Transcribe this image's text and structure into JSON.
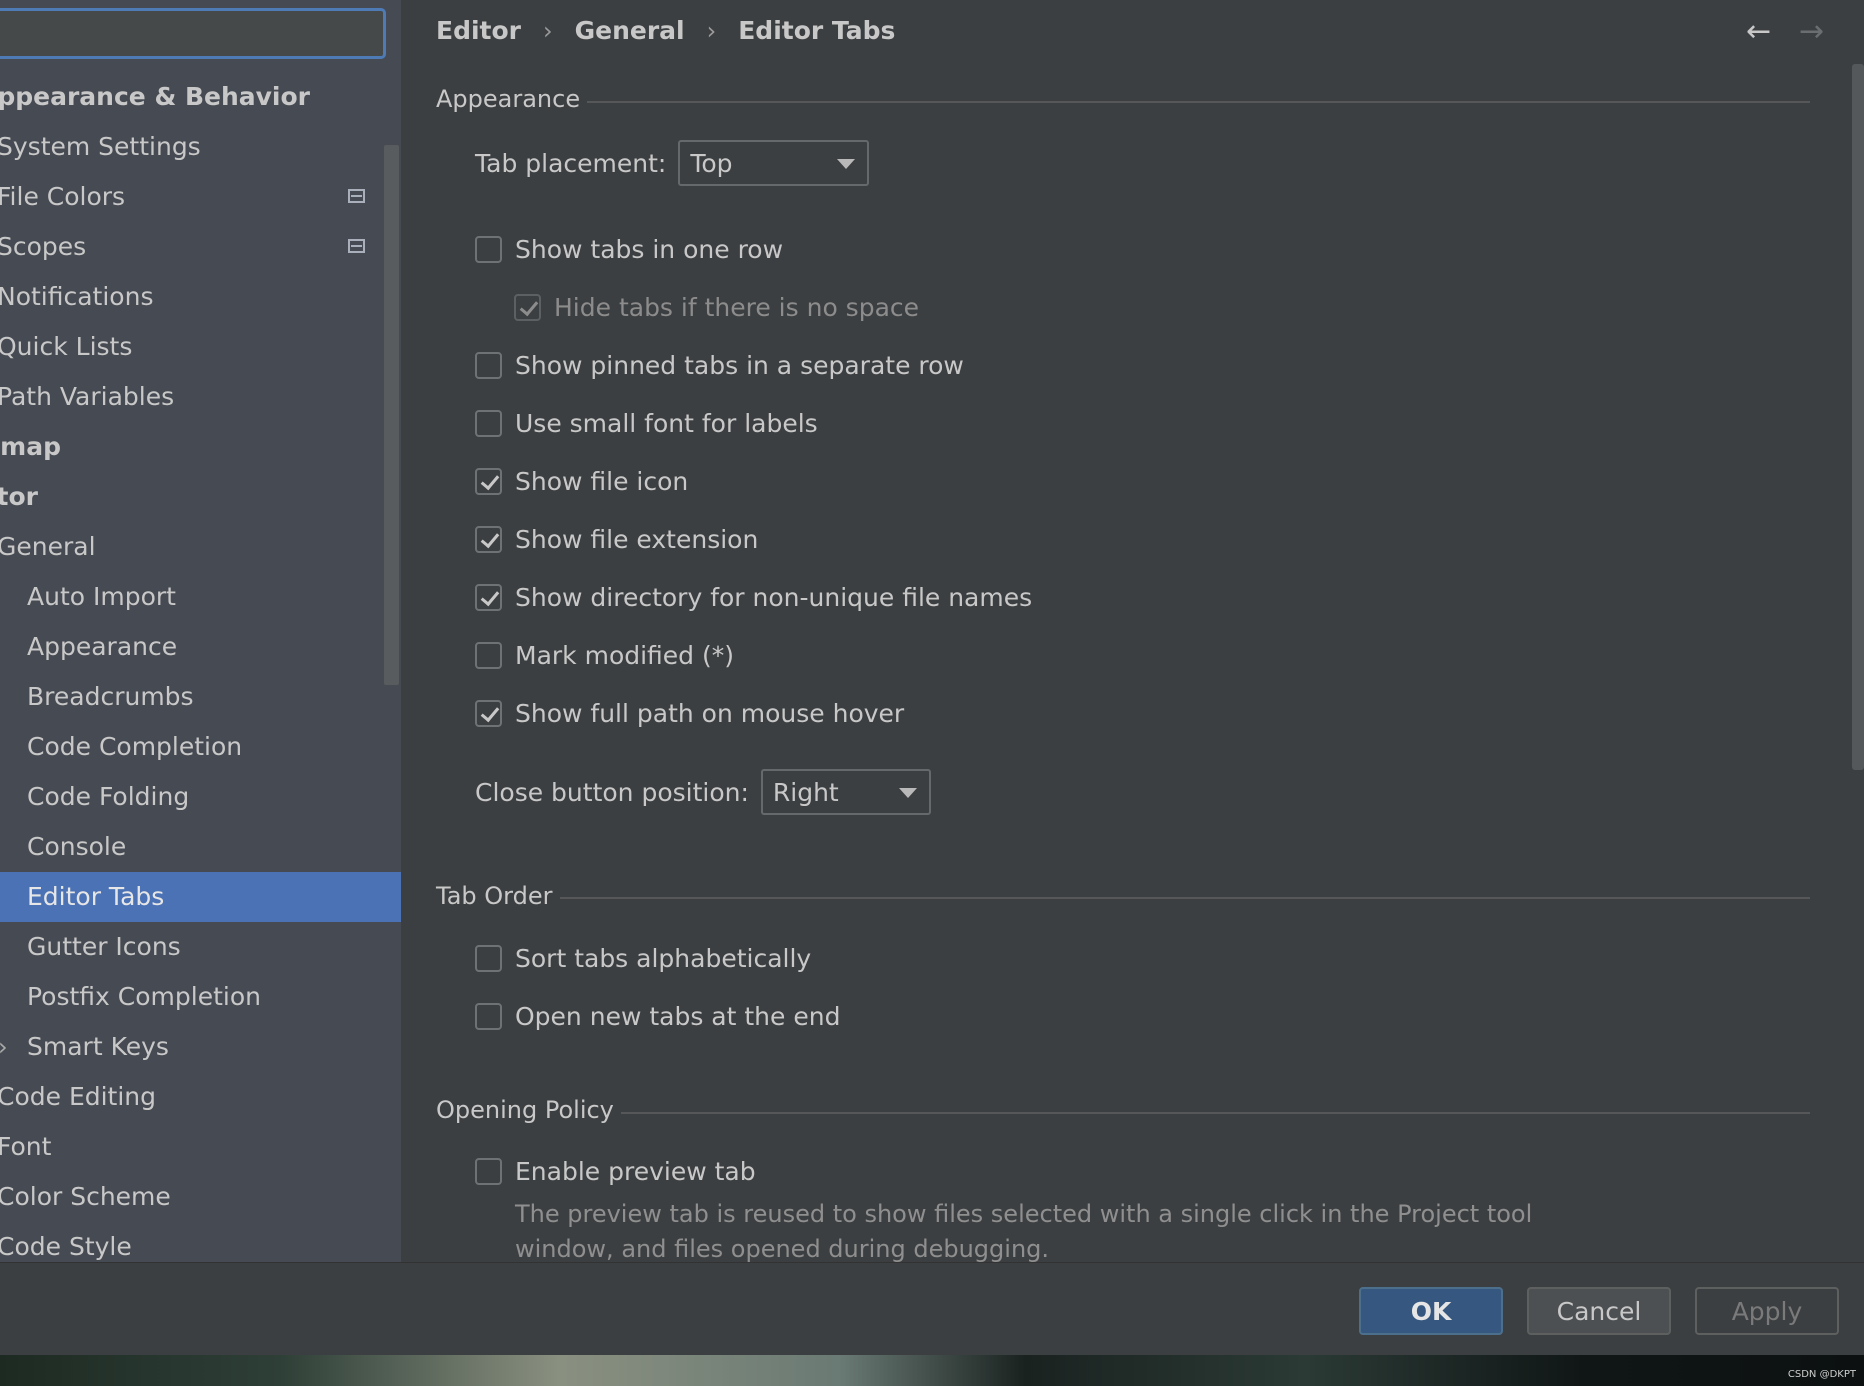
{
  "search": {
    "value": ""
  },
  "sidebar": {
    "items": [
      {
        "label": "Appearance & Behavior"
      },
      {
        "label": "System Settings"
      },
      {
        "label": "File Colors"
      },
      {
        "label": "Scopes"
      },
      {
        "label": "Notifications"
      },
      {
        "label": "Quick Lists"
      },
      {
        "label": "Path Variables"
      },
      {
        "label": "Keymap"
      },
      {
        "label": "Editor"
      },
      {
        "label": "General"
      },
      {
        "label": "Auto Import"
      },
      {
        "label": "Appearance"
      },
      {
        "label": "Breadcrumbs"
      },
      {
        "label": "Code Completion"
      },
      {
        "label": "Code Folding"
      },
      {
        "label": "Console"
      },
      {
        "label": "Editor Tabs"
      },
      {
        "label": "Gutter Icons"
      },
      {
        "label": "Postfix Completion"
      },
      {
        "label": "Smart Keys"
      },
      {
        "label": "Code Editing"
      },
      {
        "label": "Font"
      },
      {
        "label": "Color Scheme"
      },
      {
        "label": "Code Style"
      }
    ]
  },
  "breadcrumb": {
    "part1": "Editor",
    "part2": "General",
    "part3": "Editor Tabs",
    "separator": "›"
  },
  "nav": {
    "back": "←",
    "forward": "→"
  },
  "appearance": {
    "title": "Appearance",
    "tab_placement_label": "Tab placement:",
    "tab_placement_value": "Top",
    "options": [
      {
        "label": "Show tabs in one row",
        "checked": false
      },
      {
        "label": "Hide tabs if there is no space",
        "checked": true
      },
      {
        "label": "Show pinned tabs in a separate row",
        "checked": false
      },
      {
        "label": "Use small font for labels",
        "checked": false
      },
      {
        "label": "Show file icon",
        "checked": true
      },
      {
        "label": "Show file extension",
        "checked": true
      },
      {
        "label": "Show directory for non-unique file names",
        "checked": true
      },
      {
        "label": "Mark modified (*)",
        "checked": false
      },
      {
        "label": "Show full path on mouse hover",
        "checked": true
      }
    ],
    "close_button_label": "Close button position:",
    "close_button_value": "Right"
  },
  "tab_order": {
    "title": "Tab Order",
    "options": [
      {
        "label": "Sort tabs alphabetically",
        "checked": false
      },
      {
        "label": "Open new tabs at the end",
        "checked": false
      }
    ]
  },
  "opening_policy": {
    "title": "Opening Policy",
    "options": [
      {
        "label": "Enable preview tab",
        "checked": false
      }
    ],
    "description_line1": "The preview tab is reused to show files selected with a single click in the Project tool",
    "description_line2": "window, and files opened during debugging."
  },
  "footer": {
    "ok": "OK",
    "cancel": "Cancel",
    "apply": "Apply"
  },
  "watermark": "CSDN @DKPT"
}
